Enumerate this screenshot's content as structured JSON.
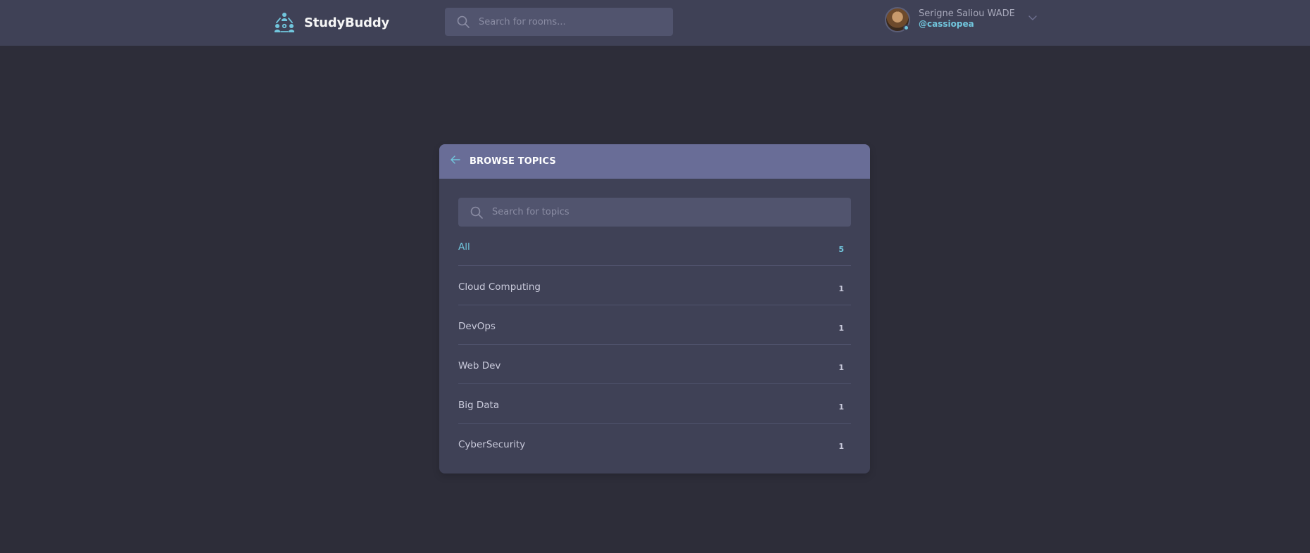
{
  "header": {
    "brand": "StudyBuddy",
    "search": {
      "placeholder": "Search for rooms...",
      "value": ""
    },
    "user": {
      "name": "Serigne Saliou WADE",
      "handle": "@cassiopea",
      "status": "online"
    }
  },
  "topics_card": {
    "title": "BROWSE TOPICS",
    "search": {
      "placeholder": "Search for topics",
      "value": ""
    },
    "items": [
      {
        "label": "All",
        "count": "5",
        "active": true
      },
      {
        "label": "Cloud Computing",
        "count": "1",
        "active": false
      },
      {
        "label": "DevOps",
        "count": "1",
        "active": false
      },
      {
        "label": "Web Dev",
        "count": "1",
        "active": false
      },
      {
        "label": "Big Data",
        "count": "1",
        "active": false
      },
      {
        "label": "CyberSecurity",
        "count": "1",
        "active": false
      }
    ]
  },
  "colors": {
    "background": "#2d2d39",
    "header": "#3f4156",
    "card": "#3f4156",
    "card_header": "#696d97",
    "input": "#51546e",
    "accent": "#71c6dd"
  },
  "icons": {
    "logo": "studybuddy-logo-icon",
    "search": "search-icon",
    "back": "arrow-left-icon",
    "dropdown": "chevron-down-icon"
  }
}
